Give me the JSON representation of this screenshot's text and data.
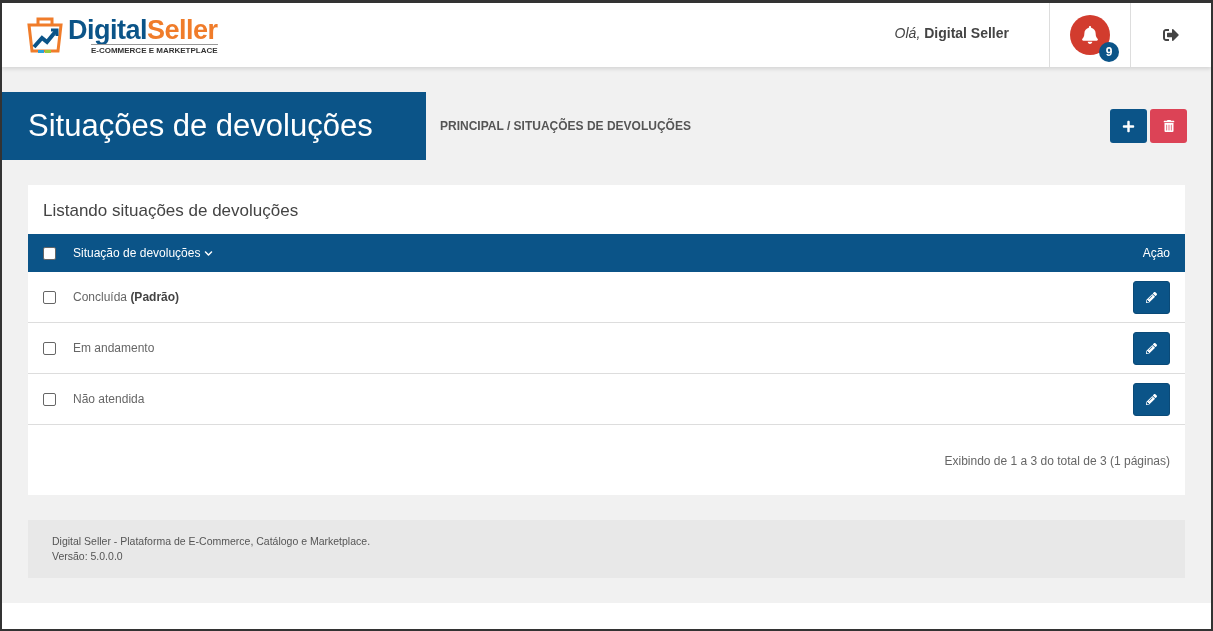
{
  "header": {
    "logo": {
      "word_1": "Digital",
      "word_2": "Seller",
      "tagline": "E-COMMERCE E MARKETPLACE"
    },
    "greeting": "*Olá,* **Digital Seller**",
    "notifications": {
      "count": "9"
    }
  },
  "page": {
    "title": "Situações de devoluções",
    "breadcrumb": "PRINCIPAL / SITUAÇÕES DE DEVOLUÇÕES"
  },
  "list": {
    "title": "Listando situações de devoluções",
    "select_all": {
      "checked": false
    },
    "columns": [
      {
        "label": "Situação de devoluções"
      },
      {
        "label": "Ação"
      }
    ],
    "rows": [
      {
        "label": "Concluída **(Padrão)**",
        "checked": false
      },
      {
        "label": "Em andamento",
        "checked": false
      },
      {
        "label": "Não atendida",
        "checked": false
      }
    ],
    "summary": "Exibindo de 1 a 3 do total de 3 (1 páginas)"
  },
  "footer": {
    "lines": [
      "Digital Seller - Plataforma de E-Commerce, Catálogo e Marketplace.",
      "Versão: 5.0.0.0"
    ]
  }
}
